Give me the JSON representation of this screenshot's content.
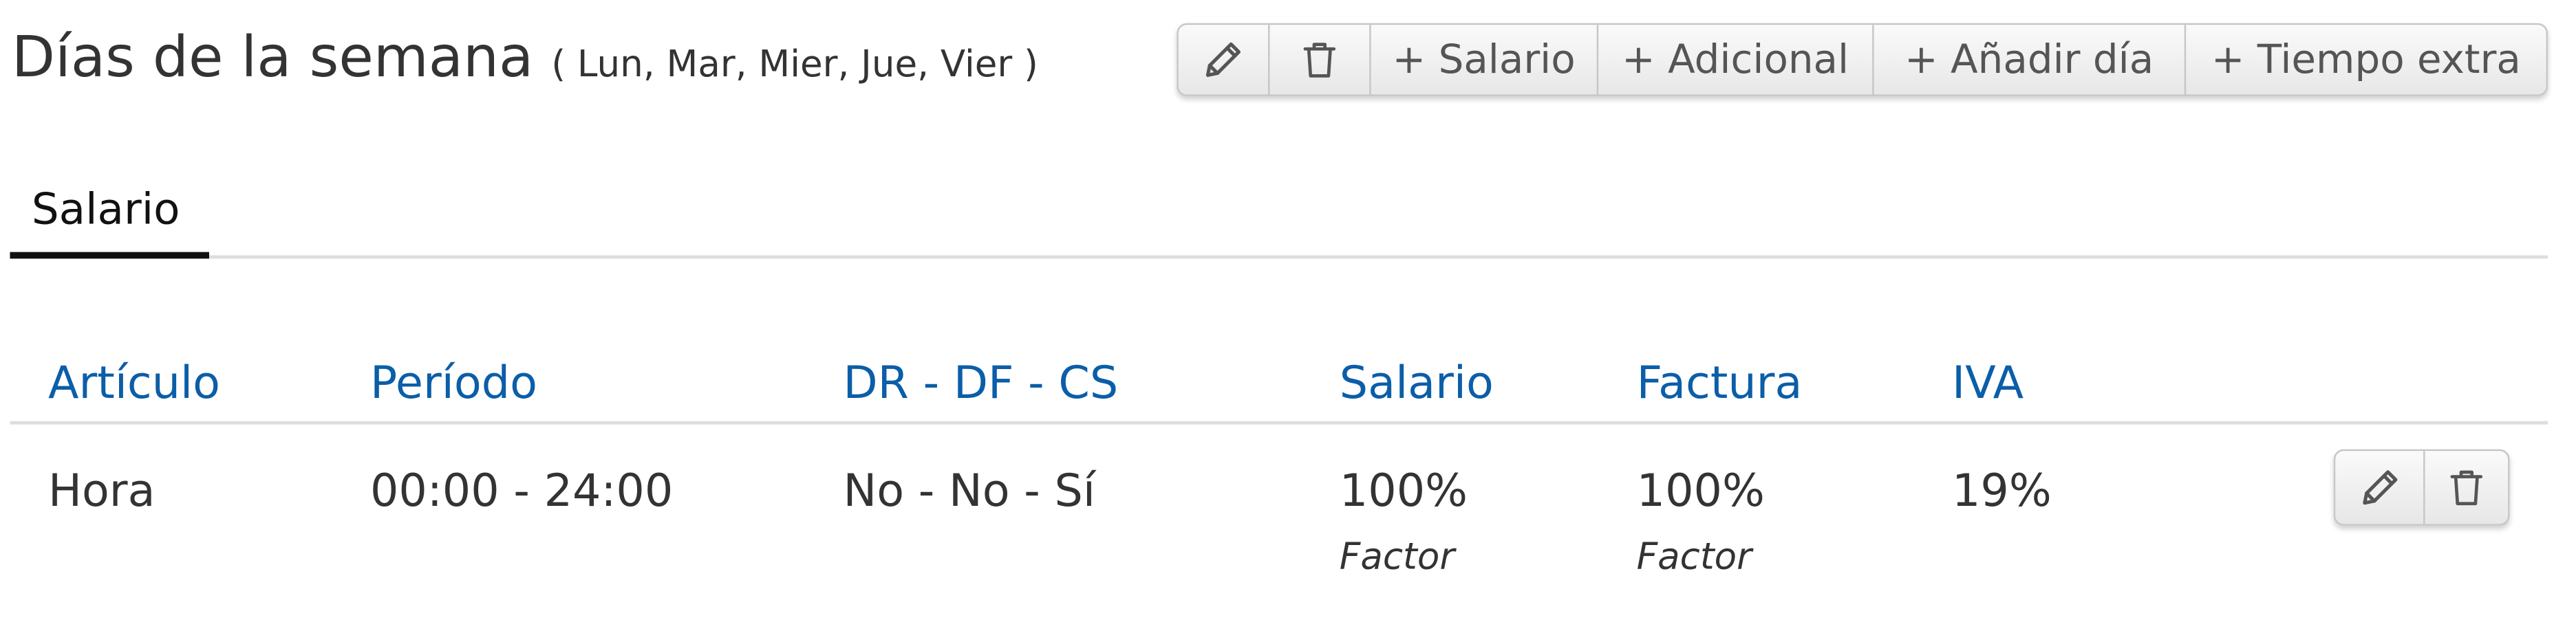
{
  "header": {
    "title": "Días de la semana",
    "subtitle": "( Lun, Mar, Mier, Jue, Vier )"
  },
  "toolbar": {
    "edit_icon": "pencil-icon",
    "delete_icon": "trash-icon",
    "add_salary_label": "+ Salario",
    "add_additional_label": "+ Adicional",
    "add_day_label": "+  Añadir día",
    "add_overtime_label": "+ Tiempo extra"
  },
  "tabs": [
    {
      "label": "Salario",
      "active": true
    }
  ],
  "table": {
    "columns": [
      "Artículo",
      "Período",
      "DR - DF - CS",
      "Salario",
      "Factura",
      "IVA"
    ],
    "rows": [
      {
        "articulo": "Hora",
        "periodo": "00:00 - 24:00",
        "dr_df_cs": "No - No - Sí",
        "salario": "100%",
        "salario_sub": "Factor",
        "factura": "100%",
        "factura_sub": "Factor",
        "iva": "19%",
        "actions": [
          "pencil-icon",
          "trash-icon"
        ]
      }
    ]
  },
  "colors": {
    "accent": "#0b5ea8",
    "text": "#333333",
    "tab_active": "#111111",
    "divider": "#dddddd"
  }
}
